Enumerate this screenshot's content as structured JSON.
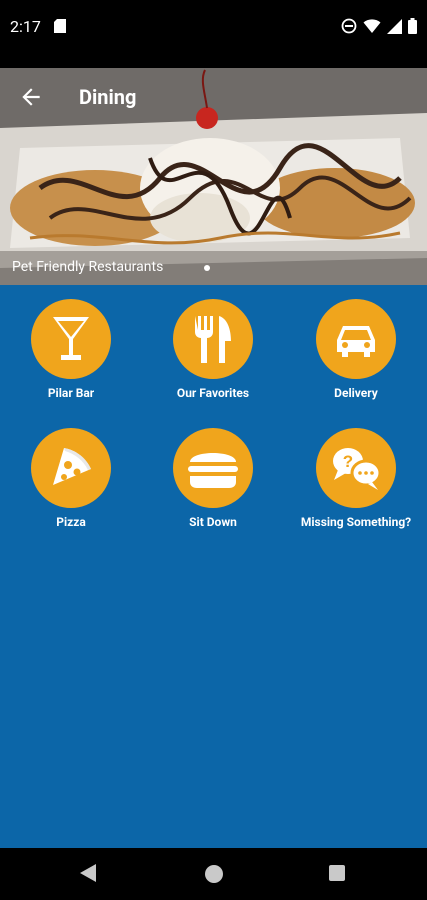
{
  "status": {
    "time": "2:17"
  },
  "header": {
    "title": "Dining",
    "caption": "Pet Friendly Restaurants"
  },
  "colors": {
    "background": "#0c66a8",
    "tile": "#f0a51c",
    "icon": "#ffffff"
  },
  "tiles": [
    {
      "label": "Pilar Bar",
      "icon": "martini-glass-icon"
    },
    {
      "label": "Our Favorites",
      "icon": "fork-knife-icon"
    },
    {
      "label": "Delivery",
      "icon": "car-icon"
    },
    {
      "label": "Pizza",
      "icon": "pizza-slice-icon"
    },
    {
      "label": "Sit Down",
      "icon": "burger-icon"
    },
    {
      "label": "Missing Something?",
      "icon": "question-chat-icon"
    }
  ]
}
